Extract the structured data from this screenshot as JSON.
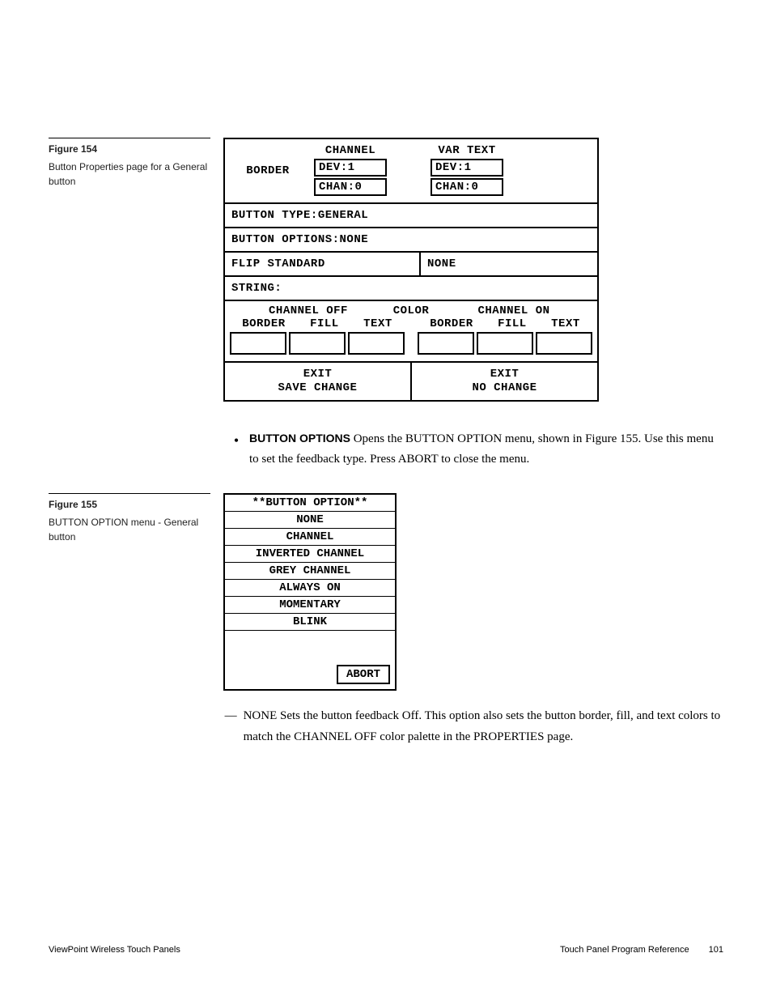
{
  "figure154": {
    "title": "Figure 154",
    "caption": "Button Properties page for a General button",
    "panel": {
      "border_label": "BORDER",
      "channel_label": "CHANNEL",
      "var_text_label": "VAR TEXT",
      "dev_chan1": "DEV:1",
      "dev_chan2": "CHAN:0",
      "dev_var1": "DEV:1",
      "dev_var2": "CHAN:0",
      "button_type": "BUTTON TYPE:GENERAL",
      "button_options": "BUTTON OPTIONS:NONE",
      "flip_left": "FLIP STANDARD",
      "flip_right": "NONE",
      "string": "STRING:",
      "ch_off": "CHANNEL OFF",
      "color": "COLOR",
      "ch_on": "CHANNEL ON",
      "sub_border": "BORDER",
      "sub_fill": "FILL",
      "sub_text": "TEXT",
      "exit_save_1": "EXIT",
      "exit_save_2": "SAVE CHANGE",
      "exit_no_1": "EXIT",
      "exit_no_2": "NO CHANGE"
    }
  },
  "body_bullet": {
    "lead_bold": "BUTTON OPTIONS",
    "text": "   Opens the BUTTON OPTION menu, shown in Figure 155. Use this menu to set the feedback type. Press ABORT to close the menu."
  },
  "figure155": {
    "title": "Figure 155",
    "caption": "BUTTON OPTION menu - General button",
    "menu": {
      "header": "**BUTTON OPTION**",
      "items": [
        "NONE",
        "CHANNEL",
        "INVERTED CHANNEL",
        "GREY CHANNEL",
        "ALWAYS ON",
        "MOMENTARY",
        "BLINK"
      ],
      "abort": "ABORT"
    }
  },
  "dash_none": {
    "lead": "NONE",
    "text": "   Sets the button feedback Off. This option also sets the button border, fill, and text colors to match the CHANNEL OFF color palette in the PROPERTIES page."
  },
  "footer": {
    "left": "ViewPoint Wireless Touch Panels",
    "right_label": "Touch Panel Program Reference",
    "page": "101"
  }
}
